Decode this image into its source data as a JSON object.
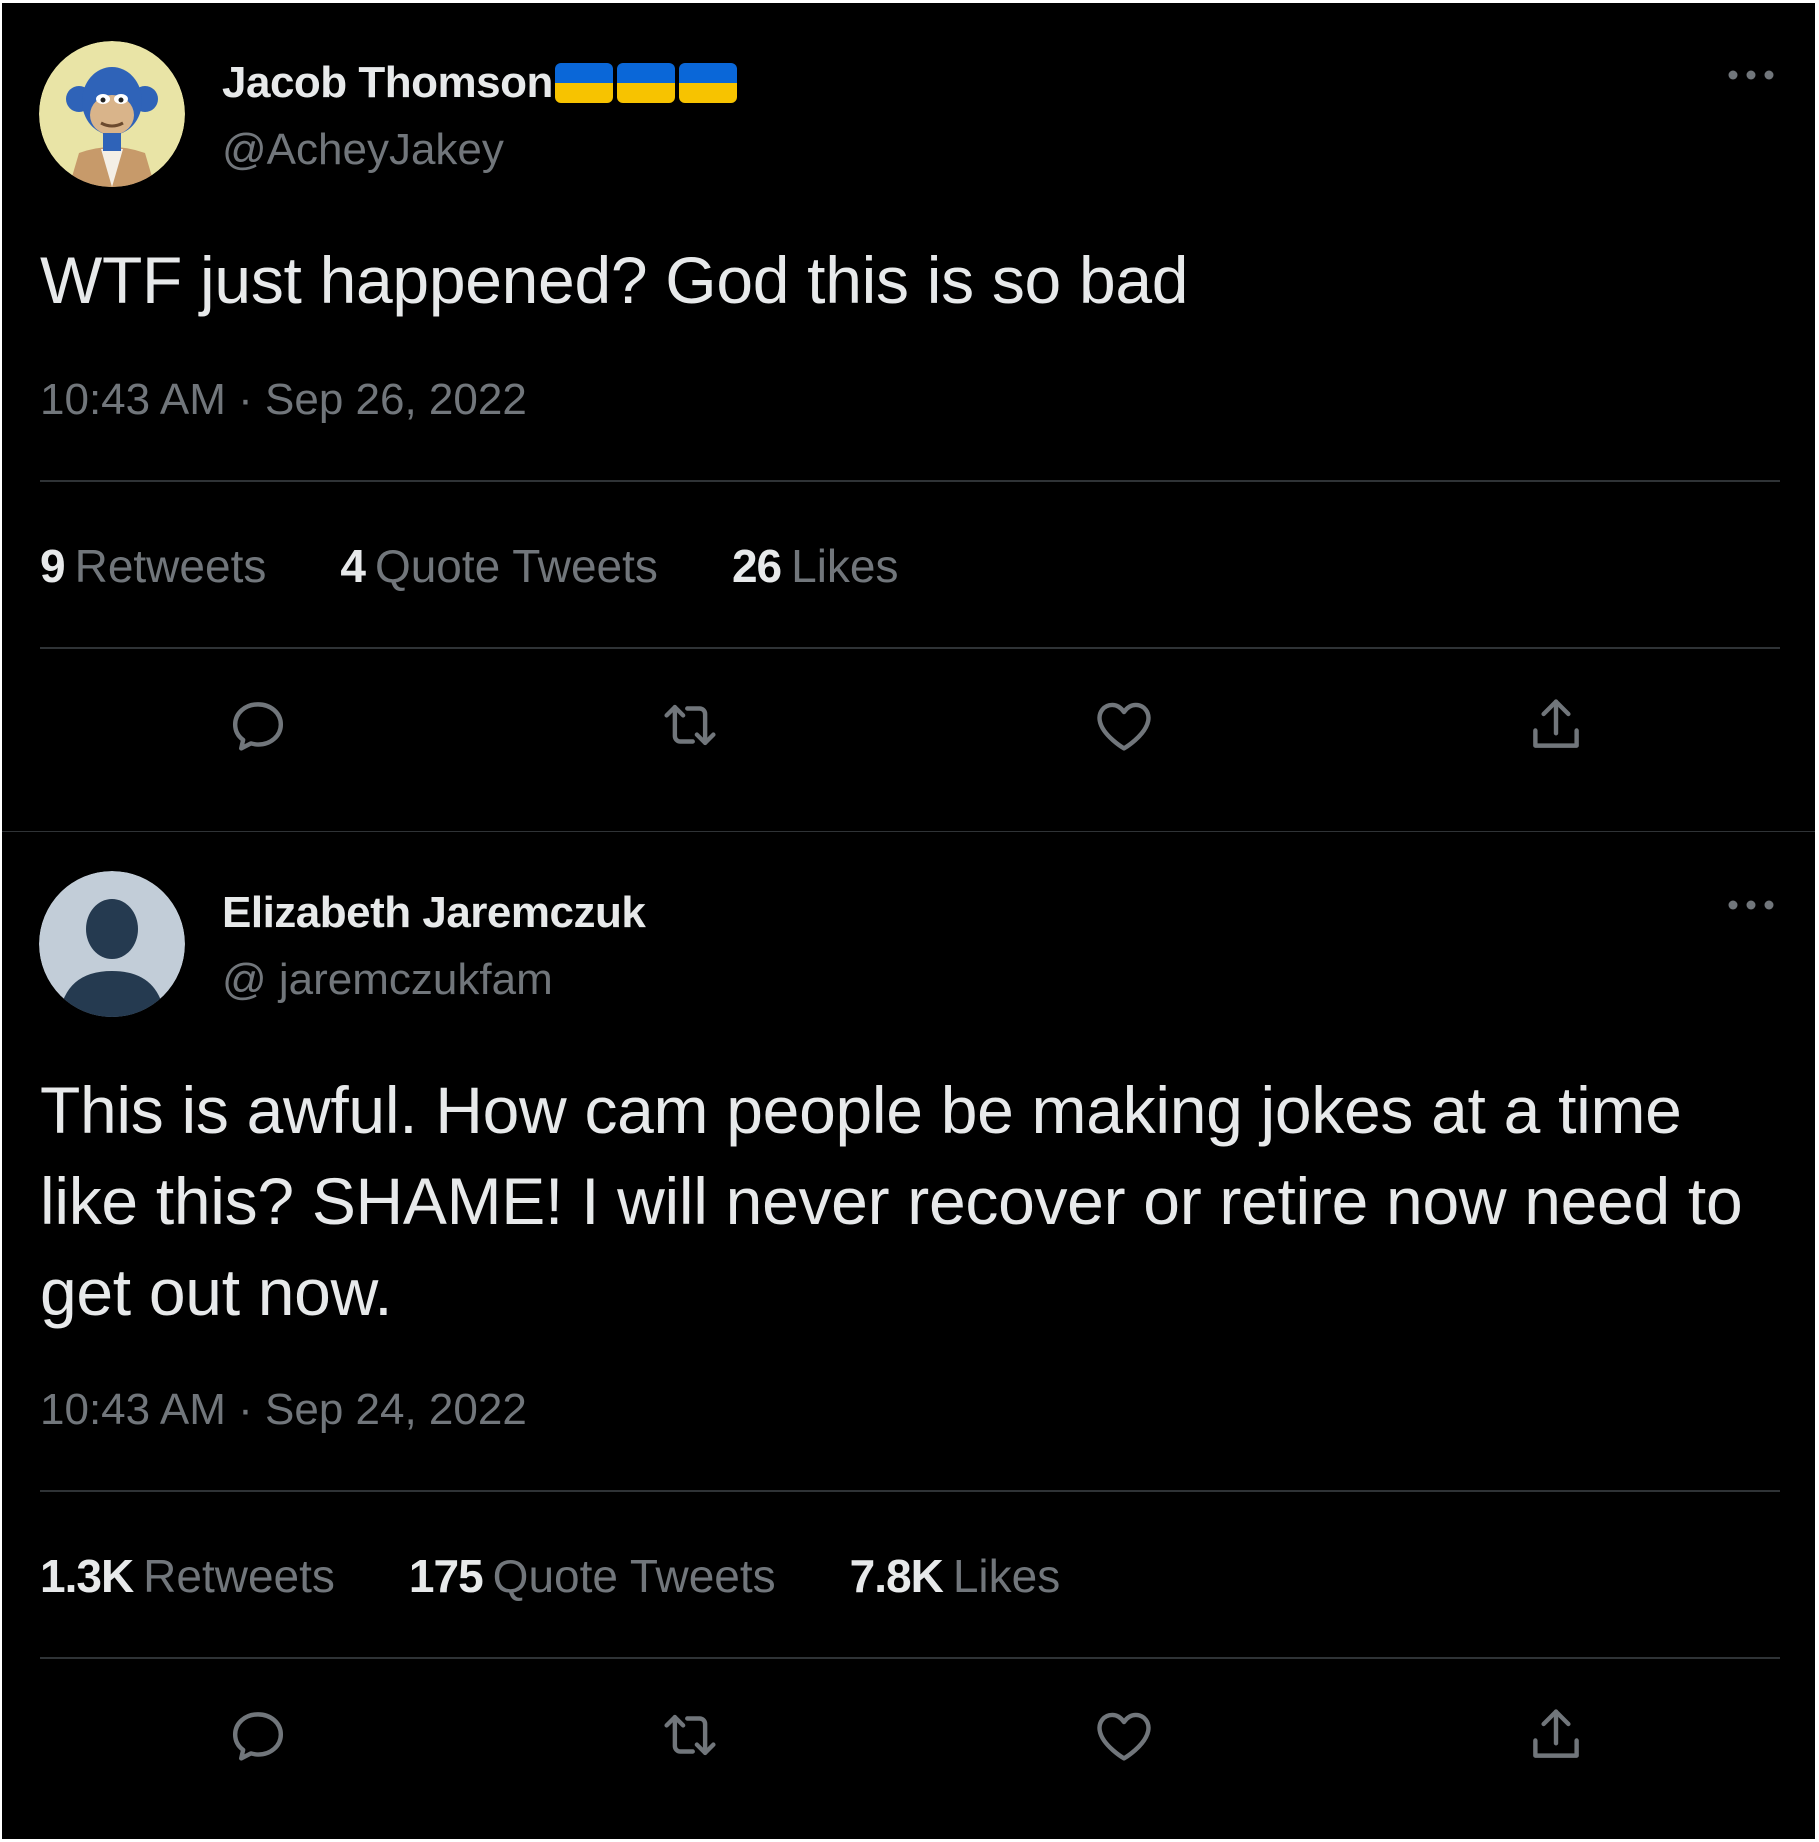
{
  "tweets": [
    {
      "author_name": "Jacob Thomson",
      "name_emoji": [
        "ukraine-flag-icon",
        "ukraine-flag-icon",
        "ukraine-flag-icon"
      ],
      "handle": "@AcheyJakey",
      "text": "WTF just happened? God this is so bad",
      "timestamp": "10:43 AM · Sep 26, 2022",
      "stats": {
        "retweets_count": "9",
        "retweets_label": "Retweets",
        "quotes_count": "4",
        "quotes_label": "Quote Tweets",
        "likes_count": "26",
        "likes_label": "Likes"
      },
      "actions": [
        "reply-icon",
        "retweet-icon",
        "like-icon",
        "share-icon"
      ]
    },
    {
      "author_name": "Elizabeth Jaremczuk",
      "handle": "@ jaremczukfam",
      "text": "This is awful. How cam people be making jokes at a time like this? SHAME! I will never recover or retire now need to get out now.",
      "timestamp": "10:43 AM · Sep 24, 2022",
      "stats": {
        "retweets_count": "1.3K",
        "retweets_label": "Retweets",
        "quotes_count": "175",
        "quotes_label": "Quote Tweets",
        "likes_count": "7.8K",
        "likes_label": "Likes"
      },
      "actions": [
        "reply-icon",
        "retweet-icon",
        "like-icon",
        "share-icon"
      ]
    }
  ],
  "colors": {
    "background": "#000000",
    "primary_text": "#e7e9ea",
    "secondary_text": "#71767b",
    "divider": "#2f3336",
    "flag_blue": "#0a67d8",
    "flag_yellow": "#f7c300"
  }
}
